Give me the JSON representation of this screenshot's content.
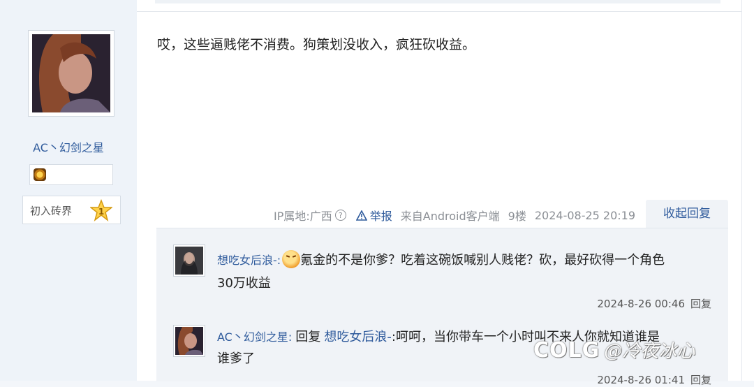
{
  "user": {
    "name": "AC丶幻剑之星",
    "rank_label": "初入砖界",
    "rank_level": "1"
  },
  "post": {
    "content": "哎，这些逼贱佬不消费。狗策划没收入，疯狂砍收益。",
    "ip_location": "IP属地:广西",
    "report_label": "举报",
    "client": "来自Android客户端",
    "floor": "9楼",
    "timestamp": "2024-08-25 20:19",
    "collapse_label": "收起回复"
  },
  "replies": [
    {
      "author": "想吃女后浪-:",
      "text_line1": "氪金的不是你爹？吃着这碗饭喊别人贱佬？砍，最好砍得一个角色",
      "text_line2": "30万收益",
      "time": "2024-8-26 00:46",
      "reply_label": "回复"
    },
    {
      "author": "AC丶幻剑之星:",
      "reply_word": "回复",
      "reply_to": "想吃女后浪-",
      "text_line1": ":呵呵，当你带车一个小时叫不来人你就知道谁是",
      "text_line2": "谁爹了",
      "time": "2024-8-26 01:41",
      "reply_label": "回复"
    }
  ],
  "watermark": {
    "logo": "COLG",
    "text": "@冷夜冰心"
  },
  "colors": {
    "link": "#2f5b9c",
    "panel": "#f0f3f7",
    "sidebar": "#eef3f9"
  },
  "icons": [
    "help-circle-icon",
    "warning-triangle-icon",
    "rank-star-icon",
    "badge-medal-icon",
    "angry-emoji-icon"
  ]
}
